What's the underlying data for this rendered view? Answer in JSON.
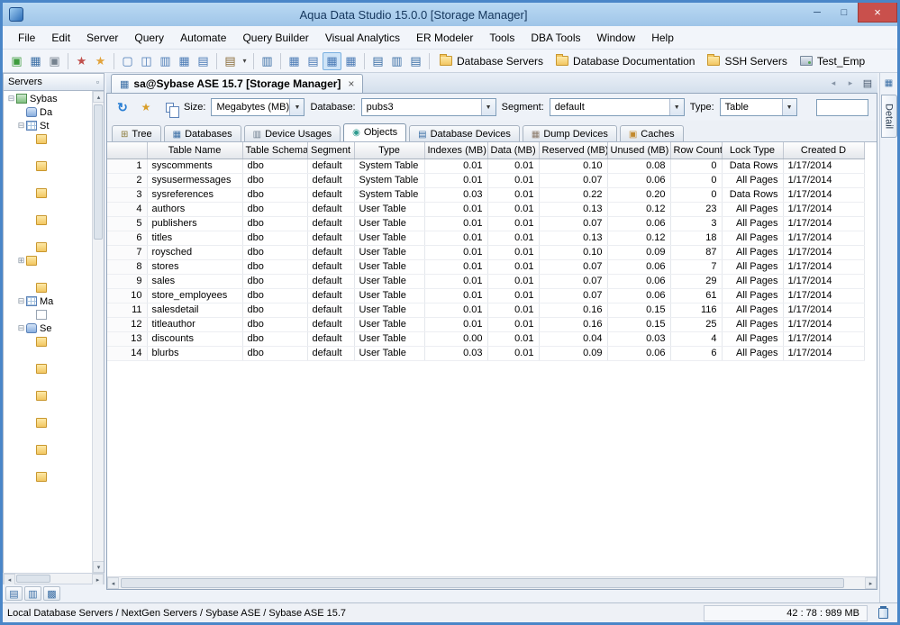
{
  "window": {
    "title": "Aqua Data Studio 15.0.0 [Storage Manager]"
  },
  "icons": {
    "minimize": "─",
    "maximize": "□",
    "close": "×",
    "nav_back": "◂",
    "nav_forward": "▸",
    "tab_list": "▤",
    "refresh": "↻",
    "wand": "★",
    "undock": "▫",
    "rail_grid": "▦",
    "scroll_up": "▴",
    "scroll_down": "▾",
    "scroll_left": "◂",
    "scroll_right": "▸",
    "doc_tab": "▦",
    "tab_close": "×",
    "combo_arrow": "▼"
  },
  "menubar": {
    "items": [
      "File",
      "Edit",
      "Server",
      "Query",
      "Automate",
      "Query Builder",
      "Visual Analytics",
      "ER Modeler",
      "Tools",
      "DBA Tools",
      "Window",
      "Help"
    ]
  },
  "toolbar": {
    "icons": [
      {
        "name": "register-server-icon",
        "glyph": "▣",
        "cls": "tbi g-green"
      },
      {
        "name": "server-group-icon",
        "glyph": "▦",
        "cls": "tbi g-blue"
      },
      {
        "name": "remove-server-icon",
        "glyph": "▣",
        "cls": "tbi g-gray"
      },
      {
        "name": "toolbar-separator",
        "glyph": "",
        "cls": "tb-sep",
        "inter": "false"
      },
      {
        "name": "automation-icon",
        "glyph": "★",
        "cls": "tbi g-red"
      },
      {
        "name": "scheduler-icon",
        "glyph": "★",
        "cls": "tbi g-orange"
      },
      {
        "name": "toolbar-separator",
        "glyph": "",
        "cls": "tb-sep",
        "inter": "false"
      },
      {
        "name": "new-window-icon",
        "glyph": "▢",
        "cls": "tbi g-frame"
      },
      {
        "name": "split-window-icon",
        "glyph": "◫",
        "cls": "tbi g-frame"
      },
      {
        "name": "cascade-windows-icon",
        "glyph": "▥",
        "cls": "tbi g-frame"
      },
      {
        "name": "tile-windows-icon",
        "glyph": "▦",
        "cls": "tbi g-frame"
      },
      {
        "name": "arrange-windows-icon",
        "glyph": "▤",
        "cls": "tbi g-frame"
      },
      {
        "name": "toolbar-separator",
        "glyph": "",
        "cls": "tb-sep",
        "inter": "false"
      },
      {
        "name": "paste-icon",
        "glyph": "▤",
        "cls": "tbi g-clip"
      },
      {
        "name": "paste-options-icon",
        "glyph": "▾",
        "cls": "tbi g-caret"
      },
      {
        "name": "toolbar-separator",
        "glyph": "",
        "cls": "tb-sep",
        "inter": "false"
      },
      {
        "name": "query-analyzer-icon",
        "glyph": "▥",
        "cls": "tbi g-blue"
      },
      {
        "name": "toolbar-separator",
        "glyph": "",
        "cls": "tb-sep",
        "inter": "false"
      },
      {
        "name": "results-grid-icon",
        "glyph": "▦",
        "cls": "tbi g-grid"
      },
      {
        "name": "results-text-icon",
        "glyph": "▤",
        "cls": "tbi g-grid"
      },
      {
        "name": "storage-manager-grid-icon",
        "glyph": "▦",
        "cls": "tbi g-grid g-active"
      },
      {
        "name": "pivot-grid-icon",
        "glyph": "▦",
        "cls": "tbi g-grid"
      },
      {
        "name": "toolbar-separator",
        "glyph": "",
        "cls": "tb-sep",
        "inter": "false"
      },
      {
        "name": "tree-view-icon",
        "glyph": "▤",
        "cls": "tbi g-blue"
      },
      {
        "name": "list-view-icon",
        "glyph": "▥",
        "cls": "tbi g-blue"
      },
      {
        "name": "details-view-icon",
        "glyph": "▤",
        "cls": "tbi g-blue"
      },
      {
        "name": "toolbar-separator",
        "glyph": "",
        "cls": "tb-sep",
        "inter": "false"
      }
    ],
    "shortcuts": [
      {
        "name": "shortcut-database-servers",
        "cls": "fi fi-folder",
        "label": "Database Servers"
      },
      {
        "name": "shortcut-database-documentation",
        "cls": "fi fi-folder",
        "label": "Database Documentation"
      },
      {
        "name": "shortcut-ssh-servers",
        "cls": "fi fi-folder",
        "label": "SSH Servers"
      },
      {
        "name": "shortcut-test-emp",
        "cls": "fi fi-server",
        "label": "Test_Emp"
      }
    ]
  },
  "sidebar": {
    "title": "Servers",
    "tree": [
      {
        "ind": 0,
        "exp": "⊟",
        "cls": "ti-server",
        "label": "Sybas"
      },
      {
        "ind": 1,
        "exp": "",
        "cls": "ti-db",
        "label": "Da"
      },
      {
        "ind": 1,
        "exp": "⊟",
        "cls": "ti-grid",
        "label": "St"
      },
      {
        "ind": 2,
        "exp": "",
        "cls": "ti-folder",
        "label": ""
      },
      {
        "ind": 4,
        "exp": "",
        "cls": "",
        "label": ""
      },
      {
        "ind": 2,
        "exp": "",
        "cls": "ti-folder",
        "label": ""
      },
      {
        "ind": 4,
        "exp": "",
        "cls": "",
        "label": ""
      },
      {
        "ind": 2,
        "exp": "",
        "cls": "ti-folder",
        "label": ""
      },
      {
        "ind": 4,
        "exp": "",
        "cls": "",
        "label": ""
      },
      {
        "ind": 2,
        "exp": "",
        "cls": "ti-folder",
        "label": ""
      },
      {
        "ind": 4,
        "exp": "",
        "cls": "",
        "label": ""
      },
      {
        "ind": 2,
        "exp": "",
        "cls": "ti-folder",
        "label": ""
      },
      {
        "ind": 1,
        "exp": "⊞",
        "cls": "ti-folder",
        "label": ""
      },
      {
        "ind": 3,
        "exp": "",
        "cls": "",
        "label": ""
      },
      {
        "ind": 2,
        "exp": "",
        "cls": "ti-folder",
        "label": ""
      },
      {
        "ind": 1,
        "exp": "⊟",
        "cls": "ti-grid",
        "label": "Ma"
      },
      {
        "ind": 2,
        "exp": "",
        "cls": "ti-doc",
        "label": ""
      },
      {
        "ind": 1,
        "exp": "⊟",
        "cls": "ti-db",
        "label": "Se"
      },
      {
        "ind": 2,
        "exp": "",
        "cls": "ti-folder",
        "label": ""
      },
      {
        "ind": 4,
        "exp": "",
        "cls": "",
        "label": ""
      },
      {
        "ind": 2,
        "exp": "",
        "cls": "ti-folder",
        "label": ""
      },
      {
        "ind": 4,
        "exp": "",
        "cls": "",
        "label": ""
      },
      {
        "ind": 2,
        "exp": "",
        "cls": "ti-folder",
        "label": ""
      },
      {
        "ind": 4,
        "exp": "",
        "cls": "",
        "label": ""
      },
      {
        "ind": 2,
        "exp": "",
        "cls": "ti-folder",
        "label": ""
      },
      {
        "ind": 4,
        "exp": "",
        "cls": "",
        "label": ""
      },
      {
        "ind": 2,
        "exp": "",
        "cls": "ti-folder",
        "label": ""
      },
      {
        "ind": 4,
        "exp": "",
        "cls": "",
        "label": ""
      },
      {
        "ind": 2,
        "exp": "",
        "cls": "ti-folder",
        "label": ""
      },
      {
        "ind": 4,
        "exp": "",
        "cls": "",
        "label": ""
      }
    ],
    "bottom_icons": [
      {
        "name": "servers-panel-icon",
        "glyph": "▤"
      },
      {
        "name": "files-panel-icon",
        "glyph": "▥"
      },
      {
        "name": "history-panel-icon",
        "glyph": "▩"
      }
    ]
  },
  "doc_tab": {
    "label": "sa@Sybase ASE 15.7 [Storage Manager]"
  },
  "controls": {
    "size": {
      "label": "Size:",
      "value": "Megabytes (MB)"
    },
    "database": {
      "label": "Database:",
      "value": "pubs3"
    },
    "segment": {
      "label": "Segment:",
      "value": "default"
    },
    "type": {
      "label": "Type:",
      "value": "Table"
    },
    "filter_value": ""
  },
  "tabs": [
    {
      "label": "Tree",
      "glyph": "⊞"
    },
    {
      "label": "Databases",
      "glyph": "▦"
    },
    {
      "label": "Device Usages",
      "glyph": "▥"
    },
    {
      "label": "Objects",
      "glyph": "◉"
    },
    {
      "label": "Database Devices",
      "glyph": "▤"
    },
    {
      "label": "Dump Devices",
      "glyph": "▦"
    },
    {
      "label": "Caches",
      "glyph": "▣"
    }
  ],
  "grid": {
    "columns": [
      "",
      "Table Name",
      "Table Schema",
      "Segment",
      "Type",
      "Indexes (MB)",
      "Data (MB)",
      "Reserved (MB)",
      "Unused (MB)",
      "Row Count",
      "Lock Type",
      "Created D"
    ],
    "rows": [
      [
        "1",
        "syscomments",
        "dbo",
        "default",
        "System Table",
        "0.01",
        "0.01",
        "0.10",
        "0.08",
        "0",
        "Data Rows",
        "1/17/2014"
      ],
      [
        "2",
        "sysusermessages",
        "dbo",
        "default",
        "System Table",
        "0.01",
        "0.01",
        "0.07",
        "0.06",
        "0",
        "All Pages",
        "1/17/2014"
      ],
      [
        "3",
        "sysreferences",
        "dbo",
        "default",
        "System Table",
        "0.03",
        "0.01",
        "0.22",
        "0.20",
        "0",
        "Data Rows",
        "1/17/2014"
      ],
      [
        "4",
        "authors",
        "dbo",
        "default",
        "User Table",
        "0.01",
        "0.01",
        "0.13",
        "0.12",
        "23",
        "All Pages",
        "1/17/2014"
      ],
      [
        "5",
        "publishers",
        "dbo",
        "default",
        "User Table",
        "0.01",
        "0.01",
        "0.07",
        "0.06",
        "3",
        "All Pages",
        "1/17/2014"
      ],
      [
        "6",
        "titles",
        "dbo",
        "default",
        "User Table",
        "0.01",
        "0.01",
        "0.13",
        "0.12",
        "18",
        "All Pages",
        "1/17/2014"
      ],
      [
        "7",
        "roysched",
        "dbo",
        "default",
        "User Table",
        "0.01",
        "0.01",
        "0.10",
        "0.09",
        "87",
        "All Pages",
        "1/17/2014"
      ],
      [
        "8",
        "stores",
        "dbo",
        "default",
        "User Table",
        "0.01",
        "0.01",
        "0.07",
        "0.06",
        "7",
        "All Pages",
        "1/17/2014"
      ],
      [
        "9",
        "sales",
        "dbo",
        "default",
        "User Table",
        "0.01",
        "0.01",
        "0.07",
        "0.06",
        "29",
        "All Pages",
        "1/17/2014"
      ],
      [
        "10",
        "store_employees",
        "dbo",
        "default",
        "User Table",
        "0.01",
        "0.01",
        "0.07",
        "0.06",
        "61",
        "All Pages",
        "1/17/2014"
      ],
      [
        "11",
        "salesdetail",
        "dbo",
        "default",
        "User Table",
        "0.01",
        "0.01",
        "0.16",
        "0.15",
        "116",
        "All Pages",
        "1/17/2014"
      ],
      [
        "12",
        "titleauthor",
        "dbo",
        "default",
        "User Table",
        "0.01",
        "0.01",
        "0.16",
        "0.15",
        "25",
        "All Pages",
        "1/17/2014"
      ],
      [
        "13",
        "discounts",
        "dbo",
        "default",
        "User Table",
        "0.00",
        "0.01",
        "0.04",
        "0.03",
        "4",
        "All Pages",
        "1/17/2014"
      ],
      [
        "14",
        "blurbs",
        "dbo",
        "default",
        "User Table",
        "0.03",
        "0.01",
        "0.09",
        "0.06",
        "6",
        "All Pages",
        "1/17/2014"
      ]
    ]
  },
  "detail_rail": {
    "label": "Detail"
  },
  "statusbar": {
    "path": "Local Database Servers / NextGen Servers / Sybase ASE / Sybase ASE 15.7",
    "memory": "42 : 78 : 989 MB"
  }
}
